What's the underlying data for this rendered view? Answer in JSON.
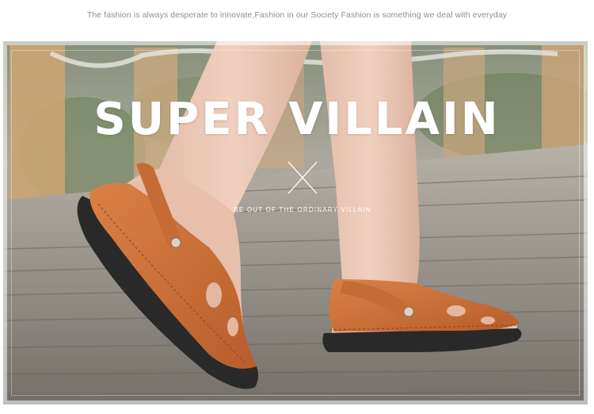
{
  "tagline": "The fashion is always desperate to innovate,Fashion in our Society Fashion is something we deal with everyday",
  "banner": {
    "headline": "SUPER VILLAIN",
    "subline": "BE OUT OF THE ORDINARY VILLAIN",
    "divider_icon": "cross-x-icon",
    "colors": {
      "headline": "#ffffff",
      "tagline": "#8f8f8f",
      "sandal_leather": "#c8642a",
      "sole": "#1c1c1c",
      "boardwalk": "#8f8b84"
    }
  }
}
